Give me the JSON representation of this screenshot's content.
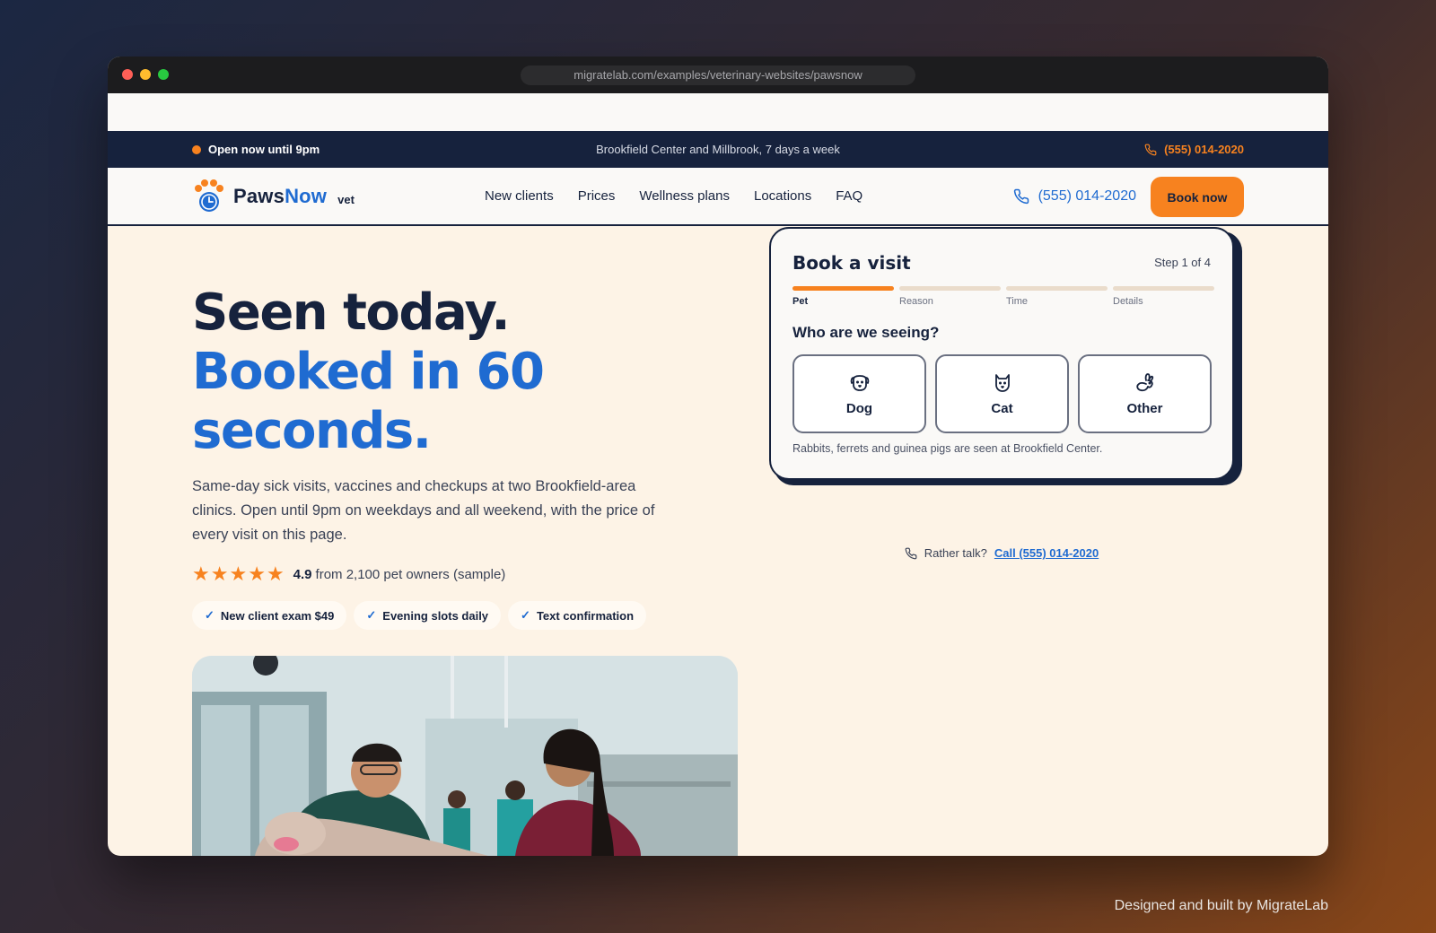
{
  "browser": {
    "url": "migratelab.com/examples/veterinary-websites/pawsnow"
  },
  "topbar": {
    "status": "Open now until 9pm",
    "locations": "Brookfield Center and Millbrook, 7 days a week",
    "phone": "(555) 014-2020"
  },
  "nav": {
    "brand_main": "Paws",
    "brand_accent": "Now",
    "brand_suffix": "vet",
    "links": [
      "New clients",
      "Prices",
      "Wellness plans",
      "Locations",
      "FAQ"
    ],
    "phone": "(555) 014-2020",
    "cta": "Book now"
  },
  "hero": {
    "line1": "Seen today.",
    "line2": "Booked in 60",
    "line3": "seconds.",
    "description": "Same-day sick visits, vaccines and checkups at two Brookfield-area clinics. Open until 9pm on weekdays and all weekend, with the price of every visit on this page.",
    "rating_score": "4.9",
    "rating_text": "from 2,100 pet owners (sample)",
    "rating_stars": 5,
    "chips": [
      "New client exam $49",
      "Evening slots daily",
      "Text confirmation"
    ]
  },
  "booking": {
    "title": "Book a visit",
    "step": "Step 1 of 4",
    "steps": [
      "Pet",
      "Reason",
      "Time",
      "Details"
    ],
    "active_step": 0,
    "question": "Who are we seeing?",
    "pets": [
      "Dog",
      "Cat",
      "Other"
    ],
    "note": "Rabbits, ferrets and guinea pigs are seen at Brookfield Center.",
    "rather_talk": "Rather talk?",
    "call_link": "Call (555) 014-2020"
  },
  "footer": {
    "credit": "Designed and built by MigrateLab"
  },
  "colors": {
    "navy": "#16223d",
    "blue": "#1f6bd1",
    "orange": "#f7821f",
    "cream": "#fdf3e6"
  }
}
